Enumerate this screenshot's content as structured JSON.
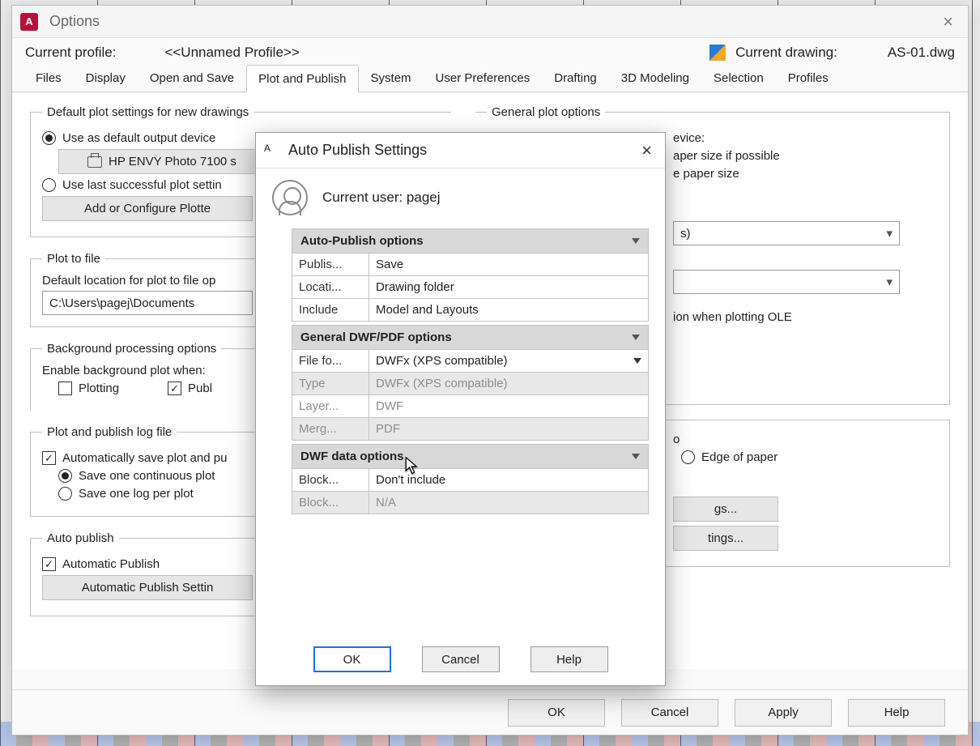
{
  "options_window": {
    "title": "Options",
    "current_profile_label": "Current profile:",
    "current_profile_value": "<<Unnamed Profile>>",
    "current_drawing_label": "Current drawing:",
    "current_drawing_value": "AS-01.dwg",
    "tabs": [
      "Files",
      "Display",
      "Open and Save",
      "Plot and Publish",
      "System",
      "User Preferences",
      "Drafting",
      "3D Modeling",
      "Selection",
      "Profiles"
    ],
    "active_tab": "Plot and Publish",
    "default_plot": {
      "legend": "Default plot settings for new drawings",
      "use_default_label": "Use as default output device",
      "printer": "HP ENVY Photo 7100 s",
      "use_last_label": "Use last successful plot settin",
      "add_configure_label": "Add or Configure Plotte"
    },
    "plot_to_file": {
      "legend": "Plot to file",
      "location_label": "Default location for plot to file op",
      "location_value": "C:\\Users\\pagej\\Documents"
    },
    "background": {
      "legend": "Background processing options",
      "enable_label": "Enable background plot when:",
      "plotting_label": "Plotting",
      "publishing_label": "Publ"
    },
    "log": {
      "legend": "Plot and publish log file",
      "auto_save_label": "Automatically save plot and pu",
      "one_continuous_label": "Save one continuous plot",
      "one_per_plot_label": "Save one log per plot"
    },
    "auto_publish": {
      "legend": "Auto publish",
      "automatic_label": "Automatic Publish",
      "settings_button": "Automatic Publish Settin"
    },
    "general_plot_options": {
      "legend": "General plot options",
      "device_suffix": "evice:",
      "paper_if_possible": "aper size if possible",
      "e_paper_size": "e paper size",
      "combo_suffix": "s)",
      "ion_ole": "ion when plotting OLE"
    },
    "offset_group": {
      "caption_suffix": "o",
      "edge_label": "Edge of paper",
      "btn1_suffix": "gs...",
      "btn2_suffix": "tings..."
    },
    "footer": {
      "ok": "OK",
      "cancel": "Cancel",
      "apply": "Apply",
      "help": "Help"
    }
  },
  "modal": {
    "title": "Auto Publish Settings",
    "current_user_label": "Current user: pagej",
    "sections": {
      "auto_publish_options": {
        "title": "Auto-Publish options",
        "rows": [
          {
            "label": "Publis...",
            "value": "Save"
          },
          {
            "label": "Locati...",
            "value": "Drawing folder"
          },
          {
            "label": "Include",
            "value": "Model and Layouts"
          }
        ]
      },
      "general_dwf_pdf": {
        "title": "General DWF/PDF options",
        "rows": [
          {
            "label": "File fo...",
            "value": "DWFx (XPS compatible)",
            "dropdown": true
          },
          {
            "label": "Type",
            "value": "DWFx (XPS compatible)",
            "grey": true,
            "shade": true
          },
          {
            "label": "Layer...",
            "value": "DWF",
            "grey": true
          },
          {
            "label": "Merg...",
            "value": "PDF",
            "grey": true,
            "shade": true
          }
        ]
      },
      "dwf_data": {
        "title": "DWF data options",
        "rows": [
          {
            "label": "Block...",
            "value": "Don't include"
          },
          {
            "label": "Block...",
            "value": "N/A",
            "grey": true,
            "shade": true
          }
        ]
      }
    },
    "footer": {
      "ok": "OK",
      "cancel": "Cancel",
      "help": "Help"
    }
  }
}
